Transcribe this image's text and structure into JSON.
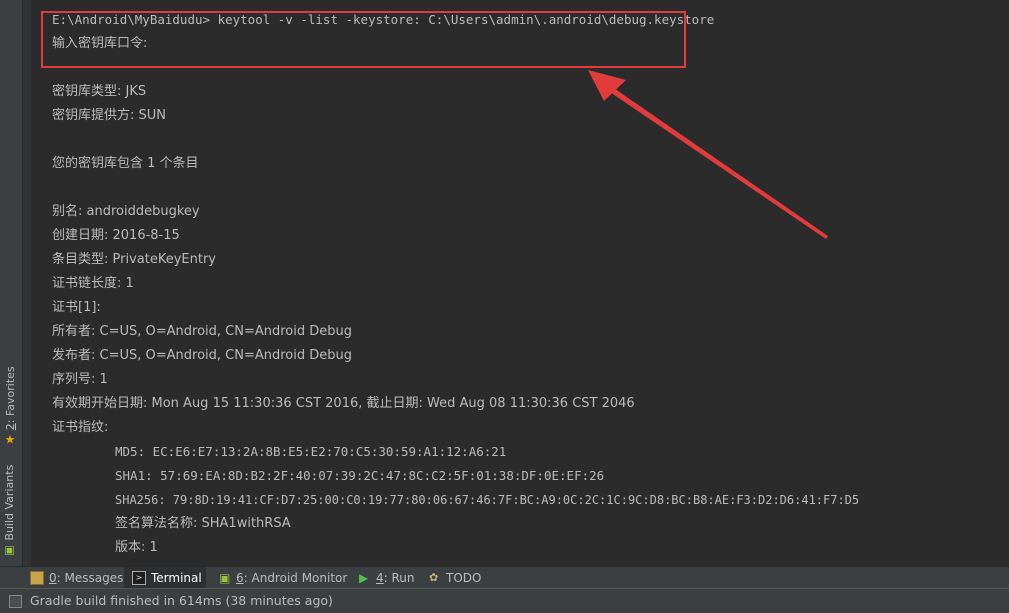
{
  "left_gutter": {
    "favorites": {
      "mnemonic": "2",
      "rest": ": Favorites"
    },
    "build_variants": {
      "label": "Build Variants"
    }
  },
  "terminal": {
    "lines": [
      "E:\\Android\\MyBaidudu> keytool -v -list -keystore: C:\\Users\\admin\\.android\\debug.keystore",
      "输入密钥库口令:",
      "密钥库类型: JKS",
      "密钥库提供方: SUN",
      "您的密钥库包含 1 个条目",
      "别名: androiddebugkey",
      "创建日期: 2016-8-15",
      "条目类型: PrivateKeyEntry",
      "证书链长度: 1",
      "证书[1]:",
      "所有者: C=US, O=Android, CN=Android Debug",
      "发布者: C=US, O=Android, CN=Android Debug",
      "序列号: 1",
      "有效期开始日期: Mon Aug 15 11:30:36 CST 2016, 截止日期: Wed Aug 08 11:30:36 CST 2046",
      "证书指纹:",
      "MD5: EC:E6:E7:13:2A:8B:E5:E2:70:C5:30:59:A1:12:A6:21",
      "SHA1: 57:69:EA:8D:B2:2F:40:07:39:2C:47:8C:C2:5F:01:38:DF:0E:EF:26",
      "SHA256: 79:8D:19:41:CF:D7:25:00:C0:19:77:80:06:67:46:7F:BC:A9:0C:2C:1C:9C:D8:BC:B8:AE:F3:D2:D6:41:F7:D5",
      "签名算法名称: SHA1withRSA",
      "版本: 1"
    ]
  },
  "annotation_colors": {
    "box": "#e23b3b",
    "arrow": "#e23b3b"
  },
  "bottom_tabs": [
    {
      "mnemonic": "0",
      "rest": ": Messages",
      "icon": "messages-icon"
    },
    {
      "label": "Terminal",
      "icon": "terminal-icon",
      "active": true
    },
    {
      "mnemonic": "6",
      "rest": ": Android Monitor",
      "icon": "android-icon"
    },
    {
      "mnemonic": "4",
      "rest": ": Run",
      "icon": "run-icon"
    },
    {
      "label": "TODO",
      "icon": "todo-icon"
    }
  ],
  "status_bar": {
    "text": "Gradle build finished in 614ms (38 minutes ago)"
  }
}
